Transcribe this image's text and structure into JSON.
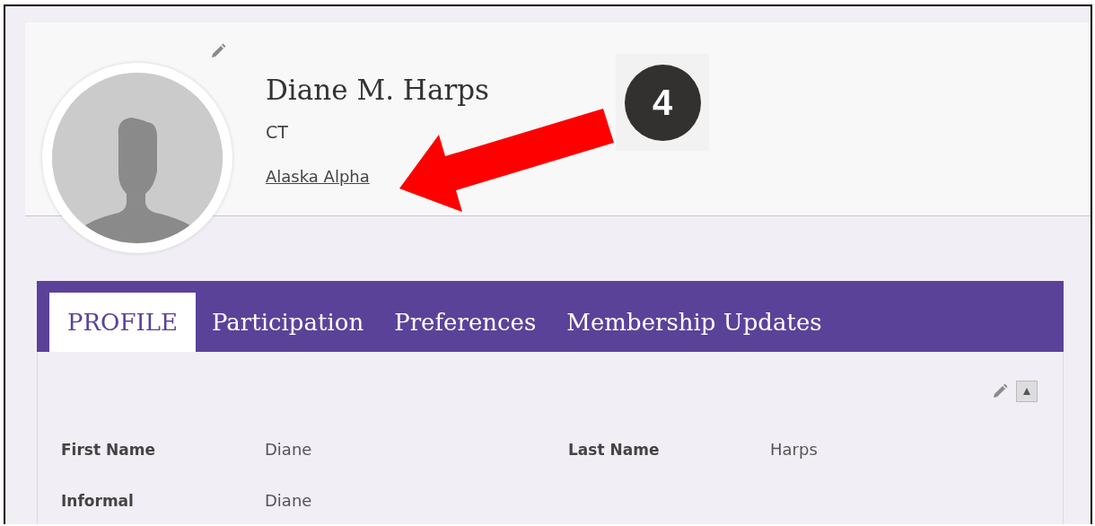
{
  "profile": {
    "name": "Diane M. Harps",
    "designation": "CT",
    "chapter_link": "Alaska Alpha"
  },
  "annotation": {
    "step_badge": "4"
  },
  "tabs": [
    {
      "label": "PROFILE",
      "selected": true
    },
    {
      "label": "Participation",
      "selected": false
    },
    {
      "label": "Preferences",
      "selected": false
    },
    {
      "label": "Membership Updates",
      "selected": false
    }
  ],
  "fields": [
    {
      "label": "First Name",
      "value": "Diane"
    },
    {
      "label": "Last Name",
      "value": "Harps"
    },
    {
      "label": "Informal",
      "value": "Diane"
    }
  ]
}
